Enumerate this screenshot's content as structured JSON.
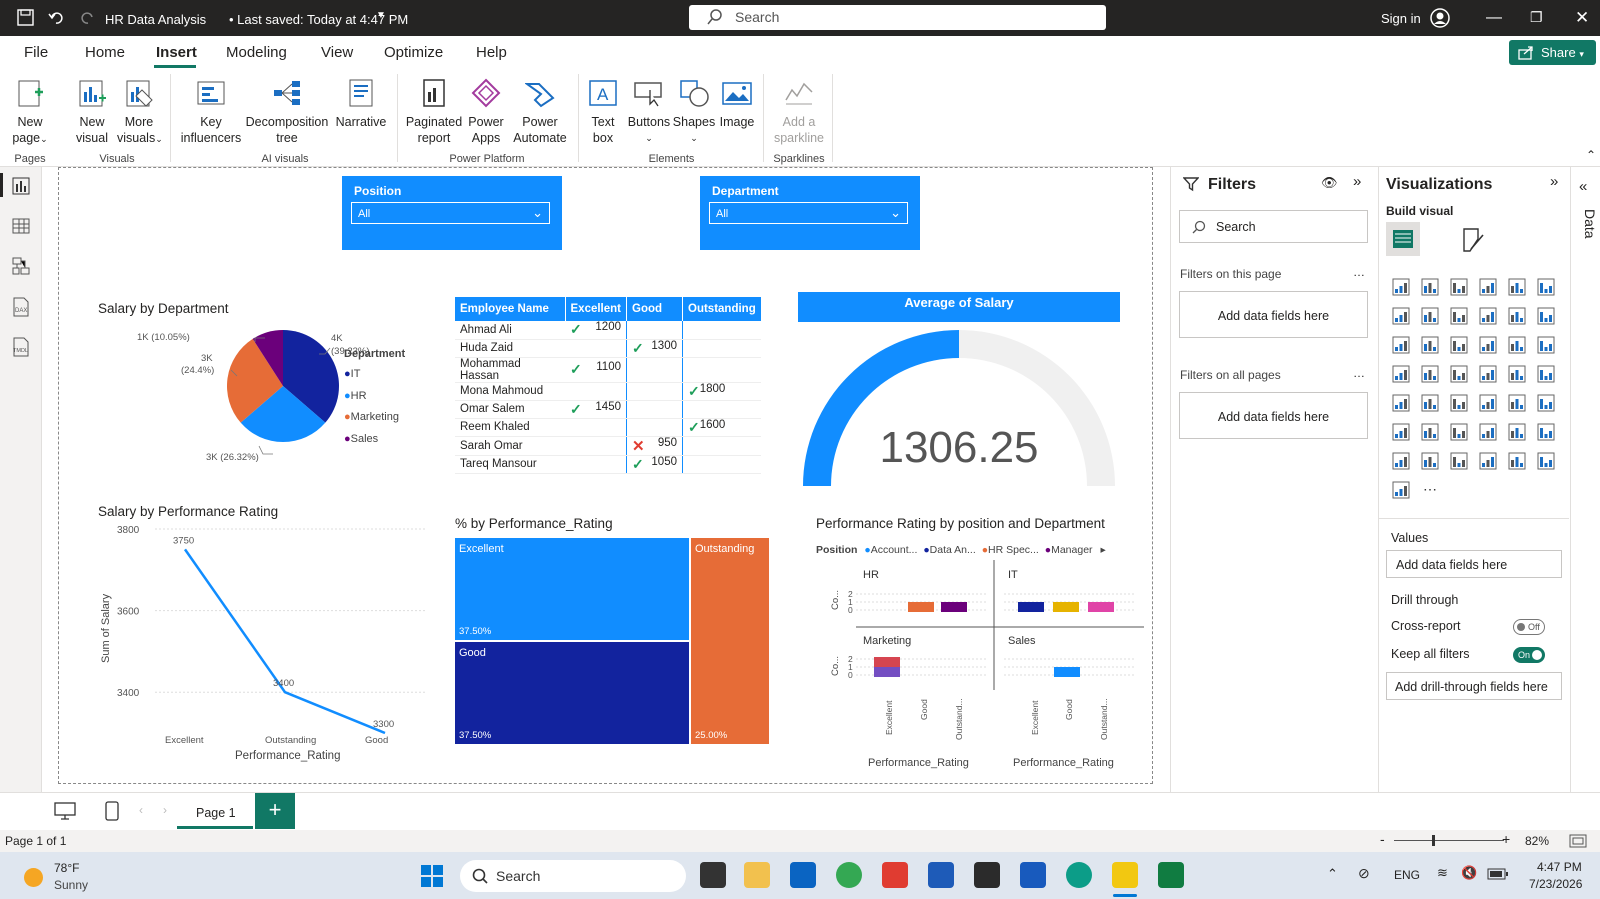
{
  "titlebar": {
    "title": "HR Data Analysis",
    "saved": "• Last saved: Today at 4:47 PM",
    "search": "Search",
    "signin": "Sign in"
  },
  "menu": {
    "file": "File",
    "home": "Home",
    "insert": "Insert",
    "modeling": "Modeling",
    "view": "View",
    "optimize": "Optimize",
    "help": "Help",
    "share": "Share"
  },
  "ribbon": {
    "new_page": [
      "New",
      "page"
    ],
    "new_visual": [
      "New",
      "visual"
    ],
    "more_visuals": [
      "More",
      "visuals"
    ],
    "key_influencers": [
      "Key",
      "influencers"
    ],
    "decomp": [
      "Decomposition",
      "tree"
    ],
    "narrative": "Narrative",
    "paginated": [
      "Paginated",
      "report"
    ],
    "power_apps": [
      "Power",
      "Apps"
    ],
    "power_automate": [
      "Power",
      "Automate"
    ],
    "text_box": [
      "Text",
      "box"
    ],
    "buttons": "Buttons",
    "shapes": "Shapes",
    "image": "Image",
    "sparkline": [
      "Add a",
      "sparkline"
    ],
    "groups": {
      "pages": "Pages",
      "visuals": "Visuals",
      "ai": "AI visuals",
      "platform": "Power Platform",
      "elements": "Elements",
      "sparklines": "Sparklines"
    }
  },
  "slicers": {
    "position": {
      "label": "Position",
      "value": "All"
    },
    "department": {
      "label": "Department",
      "value": "All"
    }
  },
  "pie": {
    "title": "Salary by Department",
    "legend_title": "Department",
    "labels": {
      "a": "1K (10.05%)",
      "b": "3K",
      "b2": "(24.4%)",
      "c": "4K",
      "c2": "(39.23%)",
      "d": "3K (26.32%)"
    },
    "legend": [
      "IT",
      "HR",
      "Marketing",
      "Sales"
    ]
  },
  "table": {
    "headers": [
      "Employee Name",
      "Excellent",
      "Good",
      "Outstanding"
    ],
    "rows": [
      {
        "name": "Ahmad Ali",
        "exc": "1200",
        "good": "",
        "out": "",
        "icon": "check",
        "col": 1
      },
      {
        "name": "Huda Zaid",
        "exc": "",
        "good": "1300",
        "out": "",
        "icon": "check",
        "col": 2
      },
      {
        "name": "Mohammad Hassan",
        "exc": "1100",
        "good": "",
        "out": "",
        "icon": "check",
        "col": 1
      },
      {
        "name": "Mona Mahmoud",
        "exc": "",
        "good": "",
        "out": "1800",
        "icon": "check",
        "col": 3
      },
      {
        "name": "Omar Salem",
        "exc": "1450",
        "good": "",
        "out": "",
        "icon": "check",
        "col": 1
      },
      {
        "name": "Reem Khaled",
        "exc": "",
        "good": "",
        "out": "1600",
        "icon": "check",
        "col": 3
      },
      {
        "name": "Sarah Omar",
        "exc": "",
        "good": "950",
        "out": "",
        "icon": "x",
        "col": 2
      },
      {
        "name": "Tareq Mansour",
        "exc": "",
        "good": "1050",
        "out": "",
        "icon": "check",
        "col": 2
      }
    ]
  },
  "gauge": {
    "title": "Average of Salary",
    "value": "1306.25",
    "fraction": 0.5
  },
  "line": {
    "title": "Salary by Performance Rating",
    "ylabel": "Sum of Salary",
    "xlabel": "Performance_Rating"
  },
  "treemap": {
    "title": "% by Performance_Rating",
    "cells": [
      {
        "name": "Excellent",
        "pct": "37.50%"
      },
      {
        "name": "Good",
        "pct": "37.50%"
      },
      {
        "name": "Outstanding",
        "pct": "25.00%"
      }
    ]
  },
  "smallmult": {
    "title": "Performance Rating by position and Department",
    "legend_label": "Position",
    "legend": [
      "Account...",
      "Data An...",
      "HR Spec...",
      "Manager"
    ],
    "panels": [
      "HR",
      "IT",
      "Marketing",
      "Sales"
    ],
    "yaxis": "Co...",
    "ticks": [
      "2",
      "1",
      "0"
    ],
    "xcats": [
      "Excellent",
      "Good",
      "Outstand..."
    ],
    "xlabel": "Performance_Rating"
  },
  "chart_data": [
    {
      "type": "pie",
      "title": "Salary by Department",
      "categories": [
        "IT",
        "HR",
        "Marketing",
        "Sales"
      ],
      "values": [
        4000,
        3000,
        3000,
        1000
      ],
      "percent": [
        39.23,
        26.32,
        24.4,
        10.05
      ]
    },
    {
      "type": "line",
      "title": "Salary by Performance Rating",
      "categories": [
        "Excellent",
        "Outstanding",
        "Good"
      ],
      "values": [
        3750,
        3400,
        3300
      ],
      "ylim": [
        3300,
        3800
      ],
      "yticks": [
        3400,
        3600,
        3800
      ],
      "xlabel": "Performance_Rating",
      "ylabel": "Sum of Salary"
    },
    {
      "type": "table",
      "title": "% by Performance_Rating",
      "categories": [
        "Excellent",
        "Good",
        "Outstanding"
      ],
      "values": [
        37.5,
        37.5,
        25.0
      ]
    }
  ],
  "filters": {
    "title": "Filters",
    "search": "Search",
    "on_page": "Filters on this page",
    "all_pages": "Filters on all pages",
    "add": "Add data fields here"
  },
  "viz": {
    "title": "Visualizations",
    "build": "Build visual",
    "values": "Values",
    "add_values": "Add data fields here",
    "drill": "Drill through",
    "cross": "Cross-report",
    "cross_state": "Off",
    "keep": "Keep all filters",
    "keep_state": "On",
    "add_drill": "Add drill-through fields here"
  },
  "data_rail": "Data",
  "tabs": {
    "page1": "Page 1"
  },
  "status": {
    "page": "Page 1 of 1",
    "zoom": "82%"
  },
  "taskbar": {
    "temp": "78°F",
    "weather": "Sunny",
    "search": "Search",
    "lang": "ENG",
    "time": "4:47 PM",
    "date": "7/23/2026"
  }
}
